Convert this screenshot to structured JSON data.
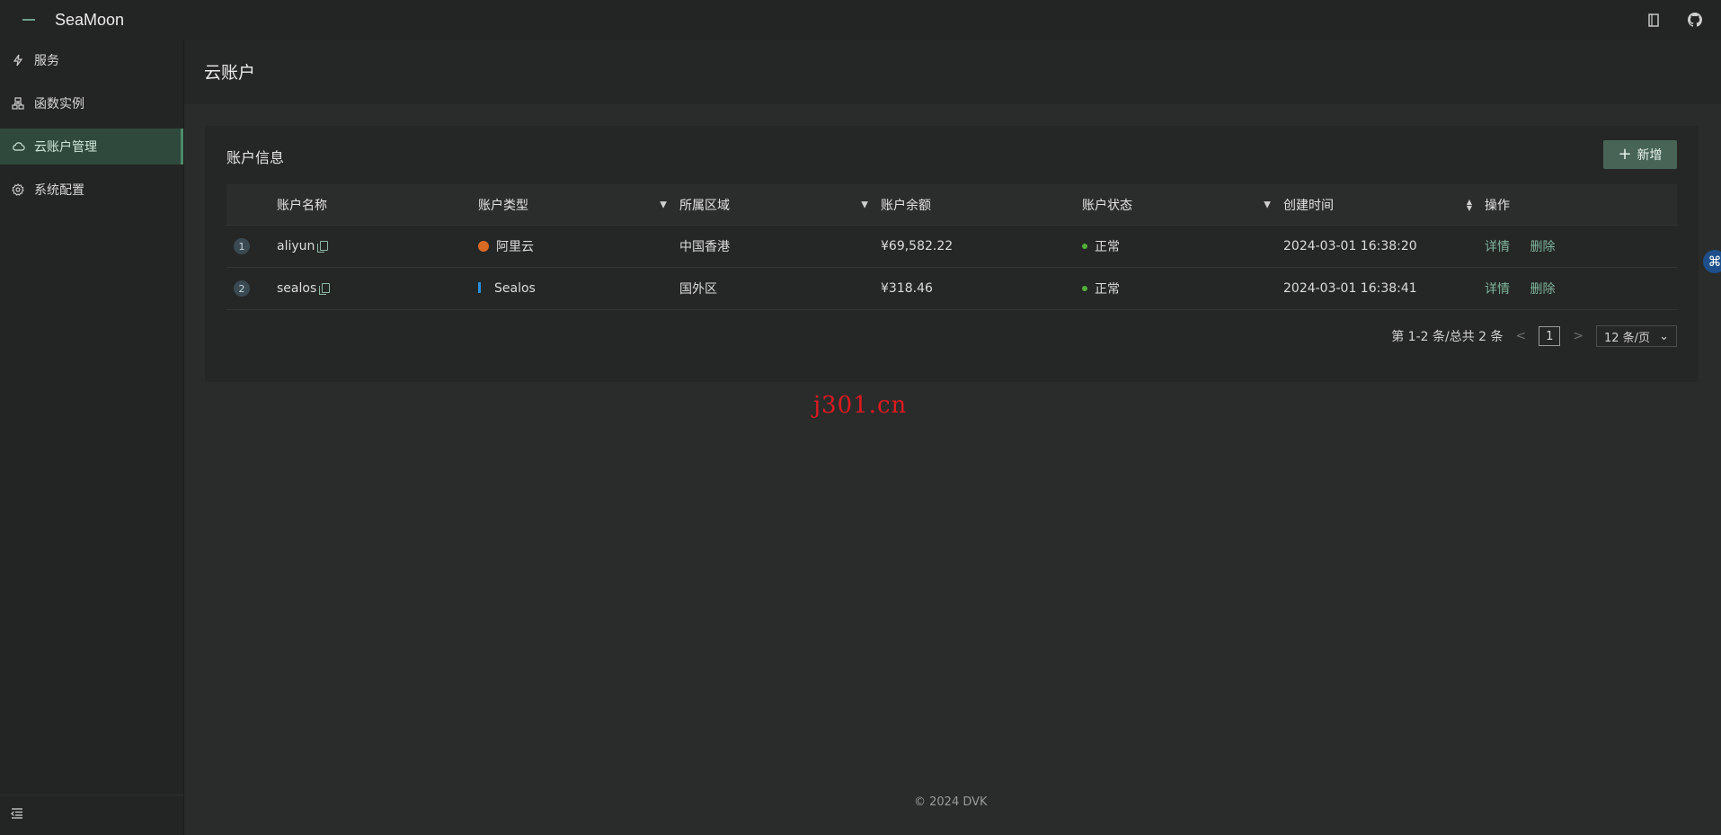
{
  "app": {
    "title": "SeaMoon"
  },
  "header_icons": [
    "book-icon",
    "github-icon"
  ],
  "sidebar": {
    "items": [
      {
        "label": "服务",
        "icon": "bolt-icon",
        "active": false
      },
      {
        "label": "函数实例",
        "icon": "cluster-icon",
        "active": false
      },
      {
        "label": "云账户管理",
        "icon": "cloud-icon",
        "active": true
      },
      {
        "label": "系统配置",
        "icon": "gear-icon",
        "active": false
      }
    ]
  },
  "page": {
    "title": "云账户"
  },
  "card": {
    "title": "账户信息",
    "add_label": "新增"
  },
  "table": {
    "columns": [
      "账户名称",
      "账户类型",
      "所属区域",
      "账户余额",
      "账户状态",
      "创建时间",
      "操作"
    ],
    "rows": [
      {
        "index": "1",
        "name": "aliyun",
        "type": "阿里云",
        "type_icon": "aliyun",
        "region": "中国香港",
        "balance": "¥69,582.22",
        "status": "正常",
        "created": "2024-03-01 16:38:20",
        "op_detail": "详情",
        "op_delete": "删除"
      },
      {
        "index": "2",
        "name": "sealos",
        "type": "Sealos",
        "type_icon": "sealos",
        "region": "国外区",
        "balance": "¥318.46",
        "status": "正常",
        "created": "2024-03-01 16:38:41",
        "op_detail": "详情",
        "op_delete": "删除"
      }
    ]
  },
  "pagination": {
    "summary": "第 1-2 条/总共 2 条",
    "current": "1",
    "page_size": "12 条/页"
  },
  "watermark": "j301.cn",
  "footer": "2024 DVK",
  "colors": {
    "accent": "#476457",
    "active_bg": "#2f4a3c",
    "link": "#7fb59c",
    "status_ok": "#52b03a"
  }
}
